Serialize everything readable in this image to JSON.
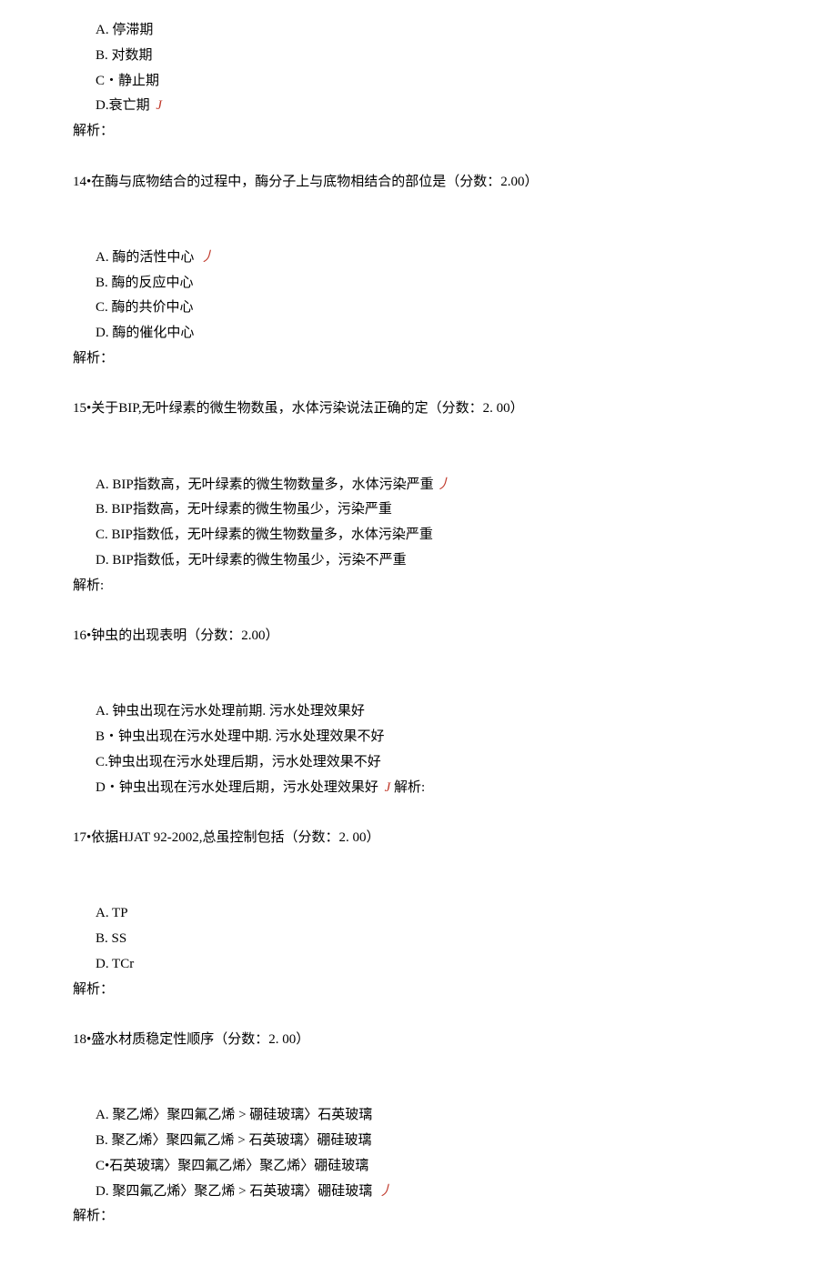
{
  "q13": {
    "optA": "A.  停滞期",
    "optB": "B.  对数期",
    "optC": "C・静止期",
    "optD_pre": "D.衰亡期 ",
    "optD_mark": "J",
    "analysis": "解析："
  },
  "q14": {
    "stem": "14•在酶与底物结合的过程中，酶分子上与底物相结合的部位是（分数：2.00）",
    "optA_pre": "A.  酶的活性中心 ",
    "optA_mark": "丿",
    "optB": "B.  酶的反应中心",
    "optC": "C.  酶的共价中心",
    "optD": "D.  酶的催化中心",
    "analysis": "解析："
  },
  "q15": {
    "stem": "15•关于BIP,无叶绿素的微生物数虽，水体污染说法正确的定（分数：2. 00）",
    "optA_pre": "A.  BIP指数高，无叶绿素的微生物数量多，水体污染严重",
    "optA_mark": "丿",
    "optB": "B.  BIP指数高，无叶绿素的微生物虽少，污染严重",
    "optC": "C.  BIP指数低，无叶绿素的微生物数量多，水体污染严重",
    "optD": "D.  BIP指数低，无叶绿素的微生物虽少，污染不严重",
    "analysis": "解析:"
  },
  "q16": {
    "stem": "16•钟虫的出现表明（分数：2.00）",
    "optA": "A.  钟虫出现在污水处理前期. 污水处理效果好",
    "optB": "B・钟虫出现在污水处理中期. 污水处理效果不好",
    "optC": "C.钟虫出现在污水处理后期，污水处理效果不好",
    "optD_pre": "D・钟虫出现在污水处理后期，污水处理效果好 ",
    "optD_mark": "J",
    "optD_post": " 解析:"
  },
  "q17": {
    "stem": "17•依据HJAT 92-2002,总虽控制包括（分数：2. 00）",
    "optA": "A.  TP",
    "optB": "B.  SS",
    "optD": "D.  TCr",
    "analysis": "解析："
  },
  "q18": {
    "stem": "18•盛水材质稳定性顺序（分数：2. 00）",
    "optA": "A.  聚乙烯〉聚四氟乙烯 > 硼硅玻璃〉石英玻璃",
    "optB": "B.  聚乙烯〉聚四氟乙烯 > 石英玻璃〉硼硅玻璃",
    "optC": "C•石英玻璃〉聚四氟乙烯〉聚乙烯〉硼硅玻璃",
    "optD_pre": "D.  聚四氟乙烯〉聚乙烯 > 石英玻璃〉硼硅玻璃 ",
    "optD_mark": "丿",
    "analysis": "解析："
  }
}
